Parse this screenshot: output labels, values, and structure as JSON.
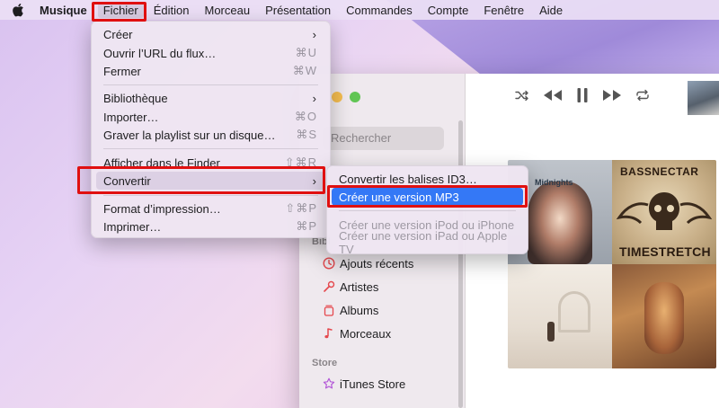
{
  "menubar": {
    "apple": "apple-logo",
    "app_name": "Musique",
    "items": [
      "Fichier",
      "Édition",
      "Morceau",
      "Présentation",
      "Commandes",
      "Compte",
      "Fenêtre",
      "Aide"
    ]
  },
  "file_menu": {
    "items": [
      {
        "label": "Créer",
        "shortcut": "",
        "submenu": true
      },
      {
        "label": "Ouvrir l’URL du flux…",
        "shortcut": "⌘U"
      },
      {
        "label": "Fermer",
        "shortcut": "⌘W"
      },
      {
        "label": "Bibliothèque",
        "shortcut": "",
        "submenu": true
      },
      {
        "label": "Importer…",
        "shortcut": "⌘O"
      },
      {
        "label": "Graver la playlist sur un disque…",
        "shortcut": "⌘S"
      },
      {
        "label": "Afficher dans le Finder",
        "shortcut": "⇧⌘R"
      },
      {
        "label": "Convertir",
        "shortcut": "",
        "submenu": true
      },
      {
        "label": "Format d’impression…",
        "shortcut": "⇧⌘P"
      },
      {
        "label": "Imprimer…",
        "shortcut": "⌘P"
      }
    ]
  },
  "convert_menu": {
    "items": [
      {
        "label": "Convertir les balises ID3…",
        "state": "normal"
      },
      {
        "label": "Créer une version MP3",
        "state": "selected"
      },
      {
        "label": "Créer une version iPod ou iPhone",
        "state": "disabled"
      },
      {
        "label": "Créer une version iPad ou Apple TV",
        "state": "disabled"
      }
    ]
  },
  "sidebar": {
    "search_placeholder": "Rechercher",
    "library_section": "Bibl",
    "items": [
      {
        "label": "Ajouts récents",
        "icon": "clock-icon"
      },
      {
        "label": "Artistes",
        "icon": "microphone-icon"
      },
      {
        "label": "Albums",
        "icon": "album-stack-icon"
      },
      {
        "label": "Morceaux",
        "icon": "music-note-icon"
      }
    ],
    "store_section": "Store",
    "store_item": {
      "label": "iTunes Store",
      "icon": "star-icon"
    }
  },
  "albums": [
    {
      "label": "Midnights"
    },
    {
      "label_top": "BASSNECTAR",
      "label_bottom": "TIMESTRETCH"
    },
    {
      "label": ""
    },
    {
      "label": ""
    }
  ],
  "colors": {
    "accent": "#3478f6",
    "highlight_box": "#e01010"
  }
}
